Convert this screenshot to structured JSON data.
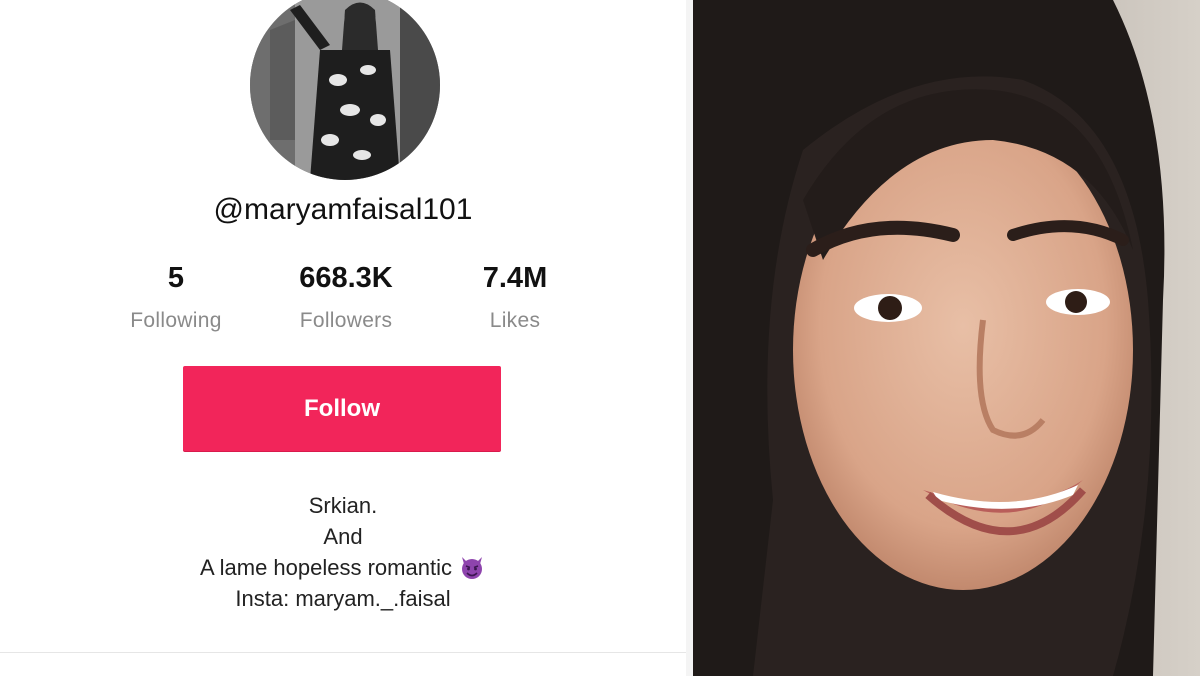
{
  "profile": {
    "username": "@maryamfaisal101",
    "avatar_icon": "profile-avatar-photo",
    "stats": [
      {
        "value": "5",
        "label": "Following"
      },
      {
        "value": "668.3K",
        "label": "Followers"
      },
      {
        "value": "7.4M",
        "label": "Likes"
      }
    ],
    "follow_label": "Follow",
    "bio": {
      "line1": "Srkian.",
      "line2": "And",
      "line3": "A lame hopeless romantic",
      "line3_emoji": "smiling-devil-emoji",
      "line4": "Insta: maryam._.faisal"
    }
  },
  "colors": {
    "follow_button": "#f2255a",
    "stat_label": "#8a8a8a",
    "emoji_purple": "#8e44ad"
  }
}
